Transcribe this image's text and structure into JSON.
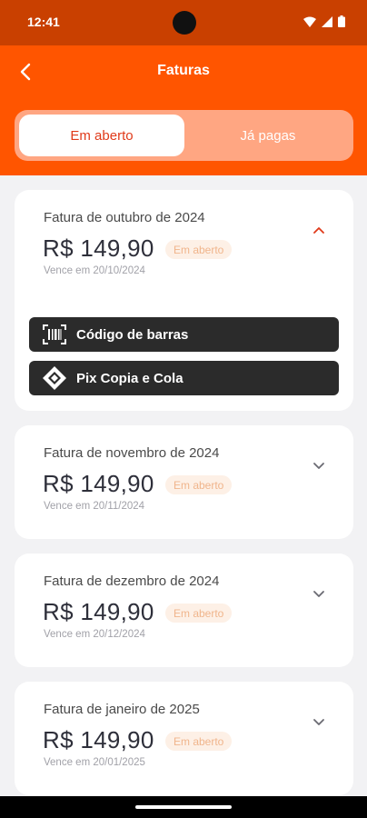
{
  "status_bar": {
    "time": "12:41"
  },
  "header": {
    "title": "Faturas"
  },
  "tabs": [
    {
      "label": "Em aberto",
      "active": true
    },
    {
      "label": "Já pagas",
      "active": false
    }
  ],
  "invoices": [
    {
      "title": "Fatura de outubro de 2024",
      "amount": "R$ 149,90",
      "status": "Em aberto",
      "due": "Vence em 20/10/2024",
      "expanded": true,
      "actions": [
        {
          "label": "Código de barras",
          "icon": "barcode-icon"
        },
        {
          "label": "Pix Copia e Cola",
          "icon": "pix-icon"
        }
      ]
    },
    {
      "title": "Fatura de novembro de 2024",
      "amount": "R$ 149,90",
      "status": "Em aberto",
      "due": "Vence em 20/11/2024",
      "expanded": false
    },
    {
      "title": "Fatura de dezembro de 2024",
      "amount": "R$ 149,90",
      "status": "Em aberto",
      "due": "Vence em 20/12/2024",
      "expanded": false
    },
    {
      "title": "Fatura de janeiro de 2025",
      "amount": "R$ 149,90",
      "status": "Em aberto",
      "due": "Vence em 20/01/2025",
      "expanded": false
    }
  ],
  "colors": {
    "status_bar": "#c94000",
    "header": "#ff5500",
    "active_tab_text": "#e03a1a",
    "badge_bg": "#fdf0e6",
    "badge_text": "#f0b58c",
    "button_bg": "#2b2b2b"
  }
}
